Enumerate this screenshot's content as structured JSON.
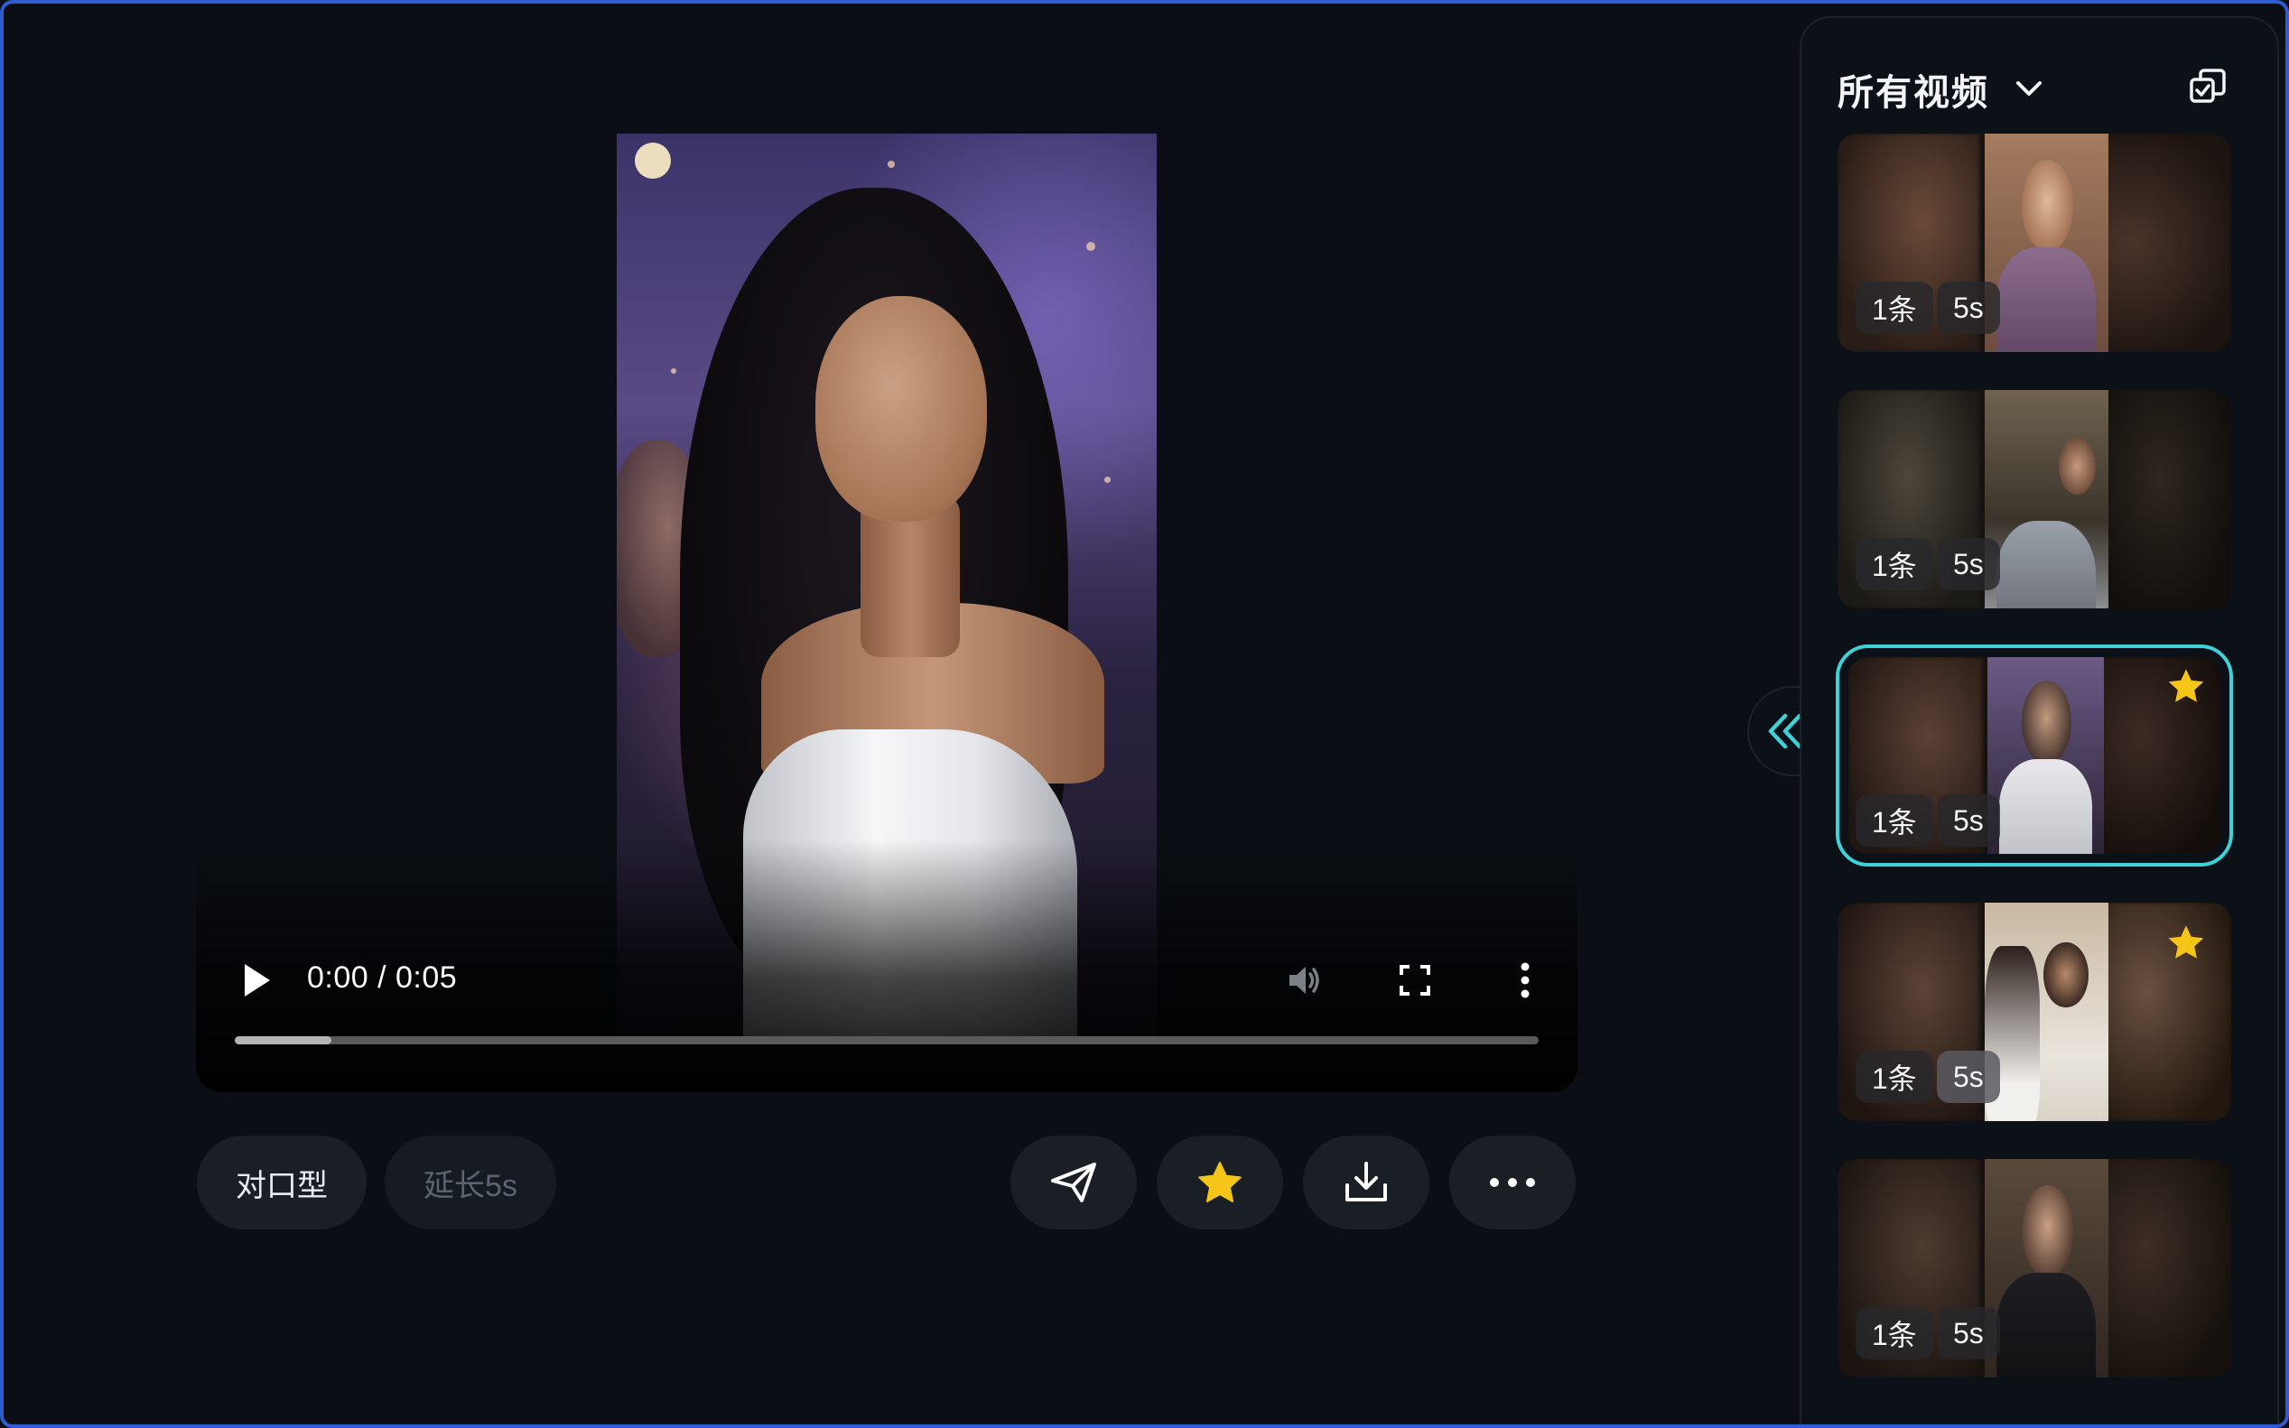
{
  "player": {
    "time_display": "0:00 / 0:05",
    "progress_played": 0.0,
    "progress_buffered": 0.074
  },
  "actions": {
    "lip_sync_label": "对口型",
    "extend_label": "延长5s"
  },
  "panel": {
    "title": "所有视频",
    "items": [
      {
        "count": "1条",
        "duration": "5s",
        "starred": false,
        "selected": false
      },
      {
        "count": "1条",
        "duration": "5s",
        "starred": false,
        "selected": false
      },
      {
        "count": "1条",
        "duration": "5s",
        "starred": true,
        "selected": true
      },
      {
        "count": "1条",
        "duration": "5s",
        "starred": true,
        "selected": false
      },
      {
        "count": "1条",
        "duration": "5s",
        "starred": false,
        "selected": false
      }
    ]
  },
  "colors": {
    "background": "#0b0f15",
    "accent_selected": "#3ed1d8",
    "star": "#f5c518",
    "frame_border": "#2f5bd3"
  },
  "icons": [
    "play-icon",
    "volume-icon",
    "fullscreen-icon",
    "more-vertical-icon",
    "send-icon",
    "star-icon",
    "download-icon",
    "more-horizontal-icon",
    "chevron-down-icon",
    "copy-icon",
    "double-chevron-left-icon"
  ]
}
